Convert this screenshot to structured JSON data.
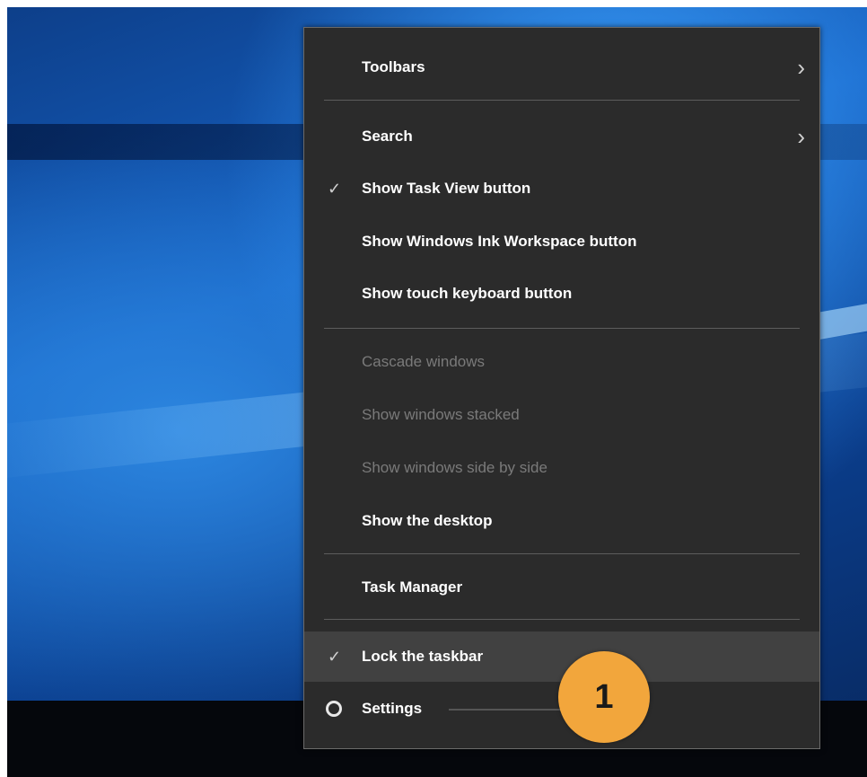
{
  "menu": {
    "items": [
      {
        "label": "Toolbars",
        "checked": false,
        "submenu": true,
        "disabled": false
      },
      {
        "label": "Search",
        "checked": false,
        "submenu": true,
        "disabled": false
      },
      {
        "label": "Show Task View button",
        "checked": true,
        "submenu": false,
        "disabled": false
      },
      {
        "label": "Show Windows Ink Workspace button",
        "checked": false,
        "submenu": false,
        "disabled": false
      },
      {
        "label": "Show touch keyboard button",
        "checked": false,
        "submenu": false,
        "disabled": false
      },
      {
        "label": "Cascade windows",
        "checked": false,
        "submenu": false,
        "disabled": true
      },
      {
        "label": "Show windows stacked",
        "checked": false,
        "submenu": false,
        "disabled": true
      },
      {
        "label": "Show windows side by side",
        "checked": false,
        "submenu": false,
        "disabled": true
      },
      {
        "label": "Show the desktop",
        "checked": false,
        "submenu": false,
        "disabled": false
      },
      {
        "label": "Task Manager",
        "checked": false,
        "submenu": false,
        "disabled": false
      },
      {
        "label": "Lock the taskbar",
        "checked": true,
        "submenu": false,
        "disabled": false,
        "highlighted": true
      },
      {
        "label": "Settings",
        "checked": false,
        "submenu": false,
        "disabled": false,
        "icon": "gear-icon"
      }
    ],
    "check_glyph": "✓",
    "submenu_glyph": "›"
  },
  "callout": {
    "number": "1",
    "color": "#f2a63c"
  },
  "colors": {
    "menu_bg": "#2b2b2b",
    "highlight_bg": "#414141",
    "disabled_text": "#7a7a7a"
  }
}
